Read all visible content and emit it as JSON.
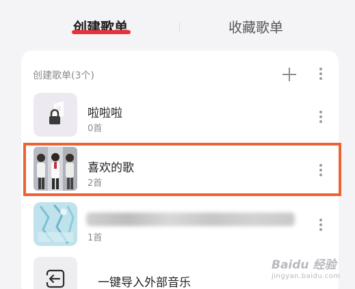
{
  "tabs": {
    "created": "创建歌单",
    "collected": "收藏歌单"
  },
  "section": {
    "title": "创建歌单(3个)"
  },
  "playlists": [
    {
      "name": "啦啦啦",
      "count": "0首",
      "icon": "lock-icon"
    },
    {
      "name": "喜欢的歌",
      "count": "2首",
      "icon": "album-cover"
    },
    {
      "name": "",
      "count": "1首",
      "icon": "album-cover-blue"
    }
  ],
  "import": {
    "label": "一键导入外部音乐",
    "icon": "import-icon"
  },
  "watermark": {
    "main": "Baidu 经验",
    "sub": "jingyan.baidu.com"
  },
  "colors": {
    "accent": "#e8323a",
    "highlight": "#ee6232"
  }
}
